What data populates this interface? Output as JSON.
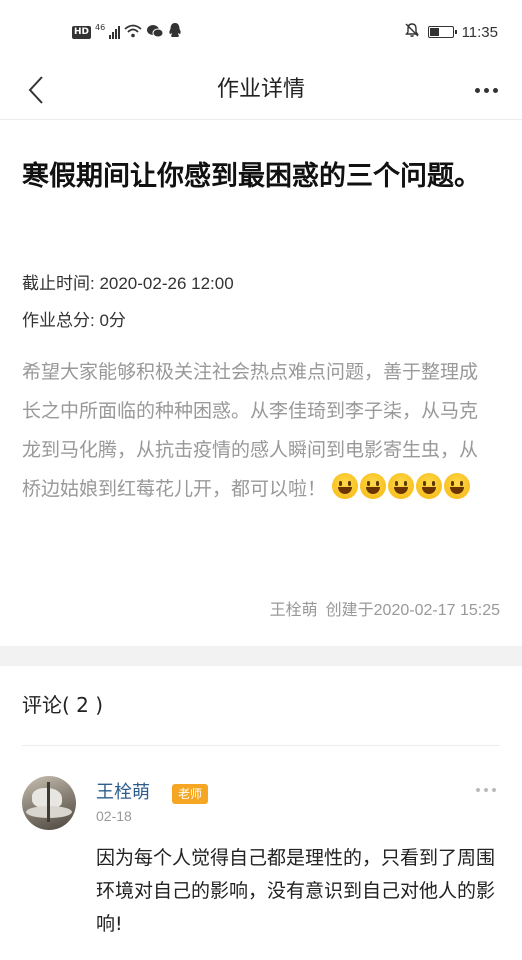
{
  "status_bar": {
    "hd": "HD",
    "network": "46",
    "time": "11:35",
    "battery_level": 0.45,
    "icons": [
      "signal-icon",
      "wifi-icon",
      "wechat-icon",
      "qq-icon",
      "mute-icon",
      "battery-icon"
    ]
  },
  "nav": {
    "title": "作业详情"
  },
  "homework": {
    "title": "寒假期间让你感到最困惑的三个问题。",
    "deadline": "截止时间: 2020-02-26 12:00",
    "total_score": "作业总分: 0分",
    "description": "希望大家能够积极关注社会热点难点问题，善于整理成长之中所面临的种种困惑。从李佳琦到李子柒，从马克龙到马化腾，从抗击疫情的感人瞬间到电影寄生虫，从桥边姑娘到红莓花儿开，都可以啦！",
    "emojis": [
      "grinning-emoji",
      "grinning-emoji",
      "smile-emoji",
      "smile-emoji",
      "smile-emoji"
    ],
    "author": "王栓萌",
    "created": "创建于2020-02-17 15:25"
  },
  "comments": {
    "header": "评论( 2 )",
    "items": [
      {
        "author": "王栓萌",
        "role": "老师",
        "date": "02-18",
        "text": "因为每个人觉得自己都是理性的，只看到了周围环境对自己的影响，没有意识到自己对他人的影响!"
      }
    ]
  },
  "colors": {
    "accent_name": "#2e5d8c",
    "badge": "#f5a623",
    "muted_text": "#999999",
    "band": "#f2f2f2"
  }
}
